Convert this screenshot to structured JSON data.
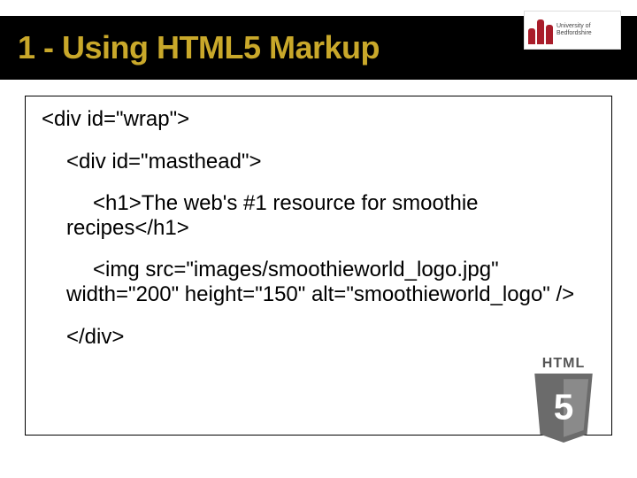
{
  "header": {
    "title": "1 - Using HTML5 Markup"
  },
  "logo": {
    "uni_top": "University of",
    "uni_bottom": "Bedfordshire"
  },
  "code": {
    "l1": "<div id=\"wrap\">",
    "l2": "<div id=\"masthead\">",
    "l3": "<h1>The web's #1 resource for smoothie recipes</h1>",
    "l4": "<img src=\"images/smoothieworld_logo.jpg\" width=\"200\" height=\"150\" alt=\"smoothieworld_logo\" />",
    "l5": "</div>"
  },
  "html5": {
    "label": "HTML",
    "num": "5"
  }
}
